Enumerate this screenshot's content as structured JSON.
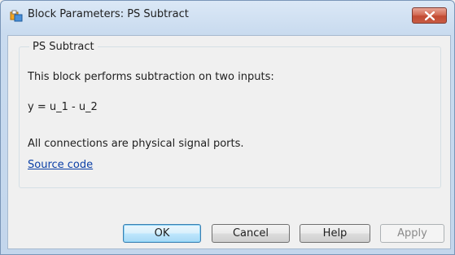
{
  "window": {
    "title": "Block Parameters: PS Subtract"
  },
  "group": {
    "title": "PS Subtract",
    "description": "This block performs subtraction on two inputs:",
    "equation": "y = u_1 - u_2",
    "note": "All connections are physical signal ports.",
    "link": "Source code"
  },
  "buttons": {
    "ok": "OK",
    "cancel": "Cancel",
    "help": "Help",
    "apply": "Apply"
  },
  "colors": {
    "link": "#0b3fa6",
    "close_button": "#c85c44"
  },
  "icons": {
    "app": "simulink-block-icon",
    "close": "close-icon"
  }
}
